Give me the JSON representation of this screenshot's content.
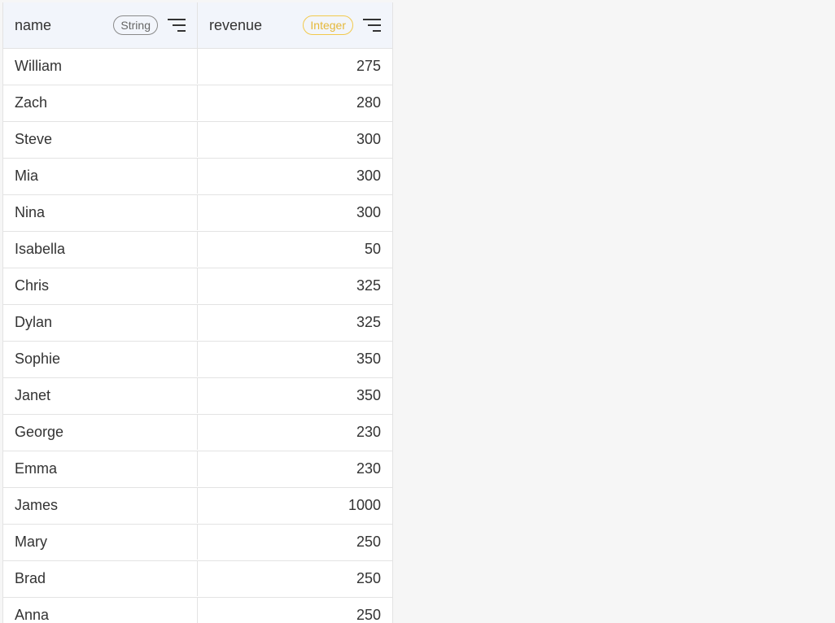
{
  "columns": [
    {
      "name": "name",
      "type": "String"
    },
    {
      "name": "revenue",
      "type": "Integer"
    }
  ],
  "rows": [
    {
      "name": "William",
      "revenue": "275"
    },
    {
      "name": "Zach",
      "revenue": "280"
    },
    {
      "name": "Steve",
      "revenue": "300"
    },
    {
      "name": "Mia",
      "revenue": "300"
    },
    {
      "name": "Nina",
      "revenue": "300"
    },
    {
      "name": "Isabella",
      "revenue": "50"
    },
    {
      "name": "Chris",
      "revenue": "325"
    },
    {
      "name": "Dylan",
      "revenue": "325"
    },
    {
      "name": "Sophie",
      "revenue": "350"
    },
    {
      "name": "Janet",
      "revenue": "350"
    },
    {
      "name": "George",
      "revenue": "230"
    },
    {
      "name": "Emma",
      "revenue": "230"
    },
    {
      "name": "James",
      "revenue": "1000"
    },
    {
      "name": "Mary",
      "revenue": "250"
    },
    {
      "name": "Brad",
      "revenue": "250"
    },
    {
      "name": "Anna",
      "revenue": "250"
    }
  ],
  "icons": {
    "column_menu": "filter-menu-icon"
  },
  "colors": {
    "string_badge": "#8a8a8a",
    "integer_badge": "#f2c94c",
    "header_bg": "#f2f5fb"
  }
}
